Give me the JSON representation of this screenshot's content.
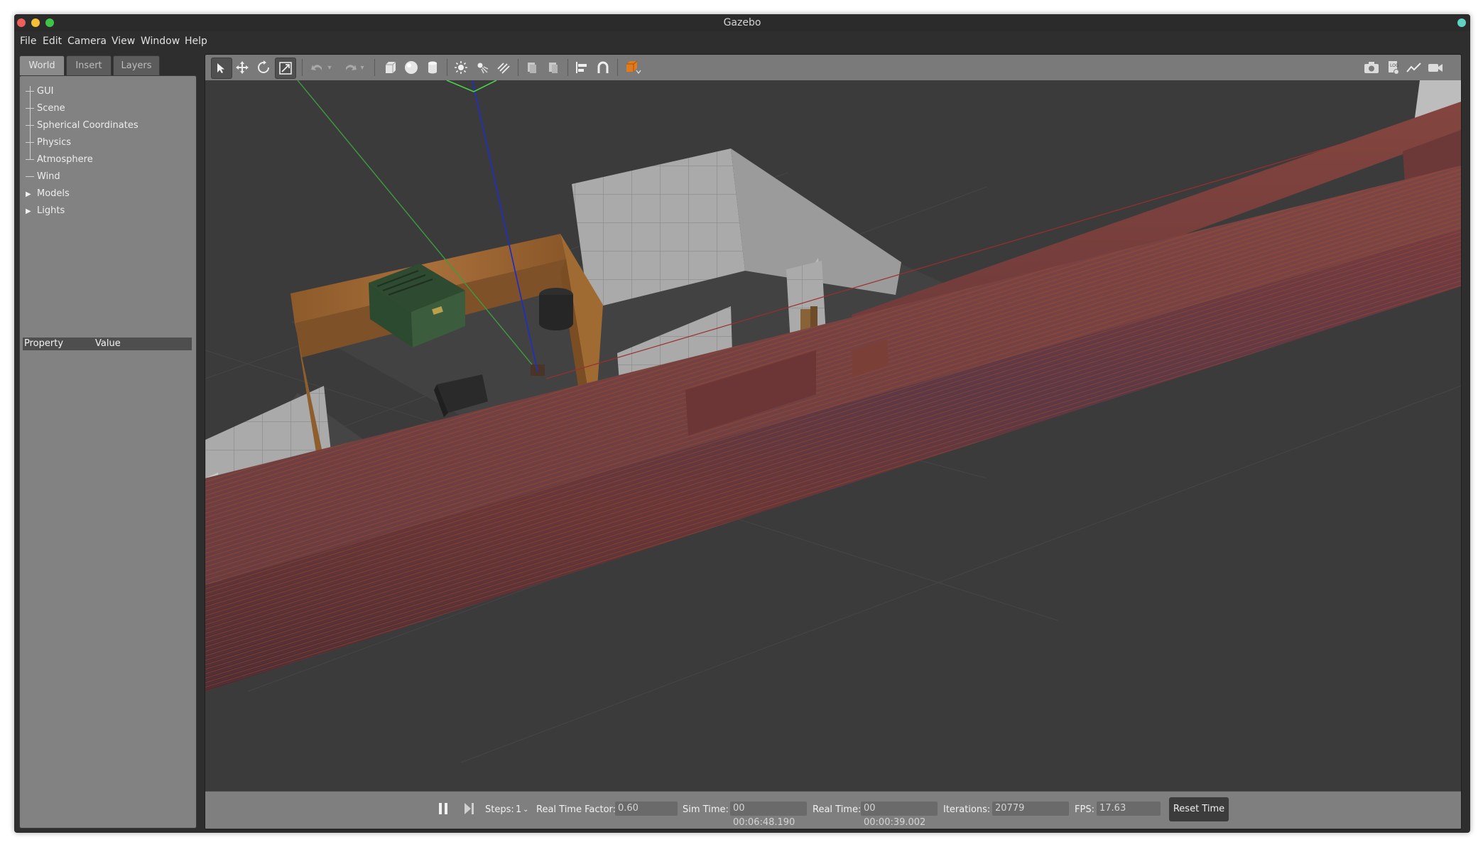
{
  "window": {
    "title": "Gazebo"
  },
  "menu": [
    "File",
    "Edit",
    "Camera",
    "View",
    "Window",
    "Help"
  ],
  "left_panel": {
    "tabs": [
      "World",
      "Insert",
      "Layers"
    ],
    "active_tab": "World",
    "tree": [
      "GUI",
      "Scene",
      "Spherical Coordinates",
      "Physics",
      "Atmosphere",
      "Wind",
      "Models",
      "Lights"
    ],
    "property_header": {
      "property": "Property",
      "value": "Value"
    }
  },
  "toolbar": {
    "icons": [
      "select-arrow-icon",
      "translate-icon",
      "rotate-icon",
      "scale-icon",
      "undo-icon",
      "undo-dropdown-icon",
      "redo-icon",
      "redo-dropdown-icon",
      "box-icon",
      "sphere-icon",
      "cylinder-icon",
      "point-light-icon",
      "spot-light-icon",
      "directional-light-icon",
      "copy-icon",
      "paste-icon",
      "align-icon",
      "snap-icon",
      "view-angle-icon"
    ],
    "right_icons": [
      "screenshot-icon",
      "log-icon",
      "plot-icon",
      "video-record-icon"
    ]
  },
  "bottom_bar": {
    "steps_label": "Steps:",
    "steps_value": "1",
    "rtf_label": "Real Time Factor:",
    "rtf_value": "0.60",
    "sim_time_label": "Sim Time:",
    "sim_time_value": "00 00:06:48.190",
    "real_time_label": "Real Time:",
    "real_time_value": "00 00:00:39.002",
    "iterations_label": "Iterations:",
    "iterations_value": "20779",
    "fps_label": "FPS:",
    "fps_value": "17.63",
    "reset_label": "Reset Time"
  },
  "colors": {
    "brick": "#6e3434",
    "wood": "#9c6633",
    "dumpster": "#2e4d32",
    "cone_orange": "#e06a1a",
    "axis_red": "#9a2f2f",
    "axis_green": "#3f9a3f",
    "axis_blue": "#2230b8"
  }
}
